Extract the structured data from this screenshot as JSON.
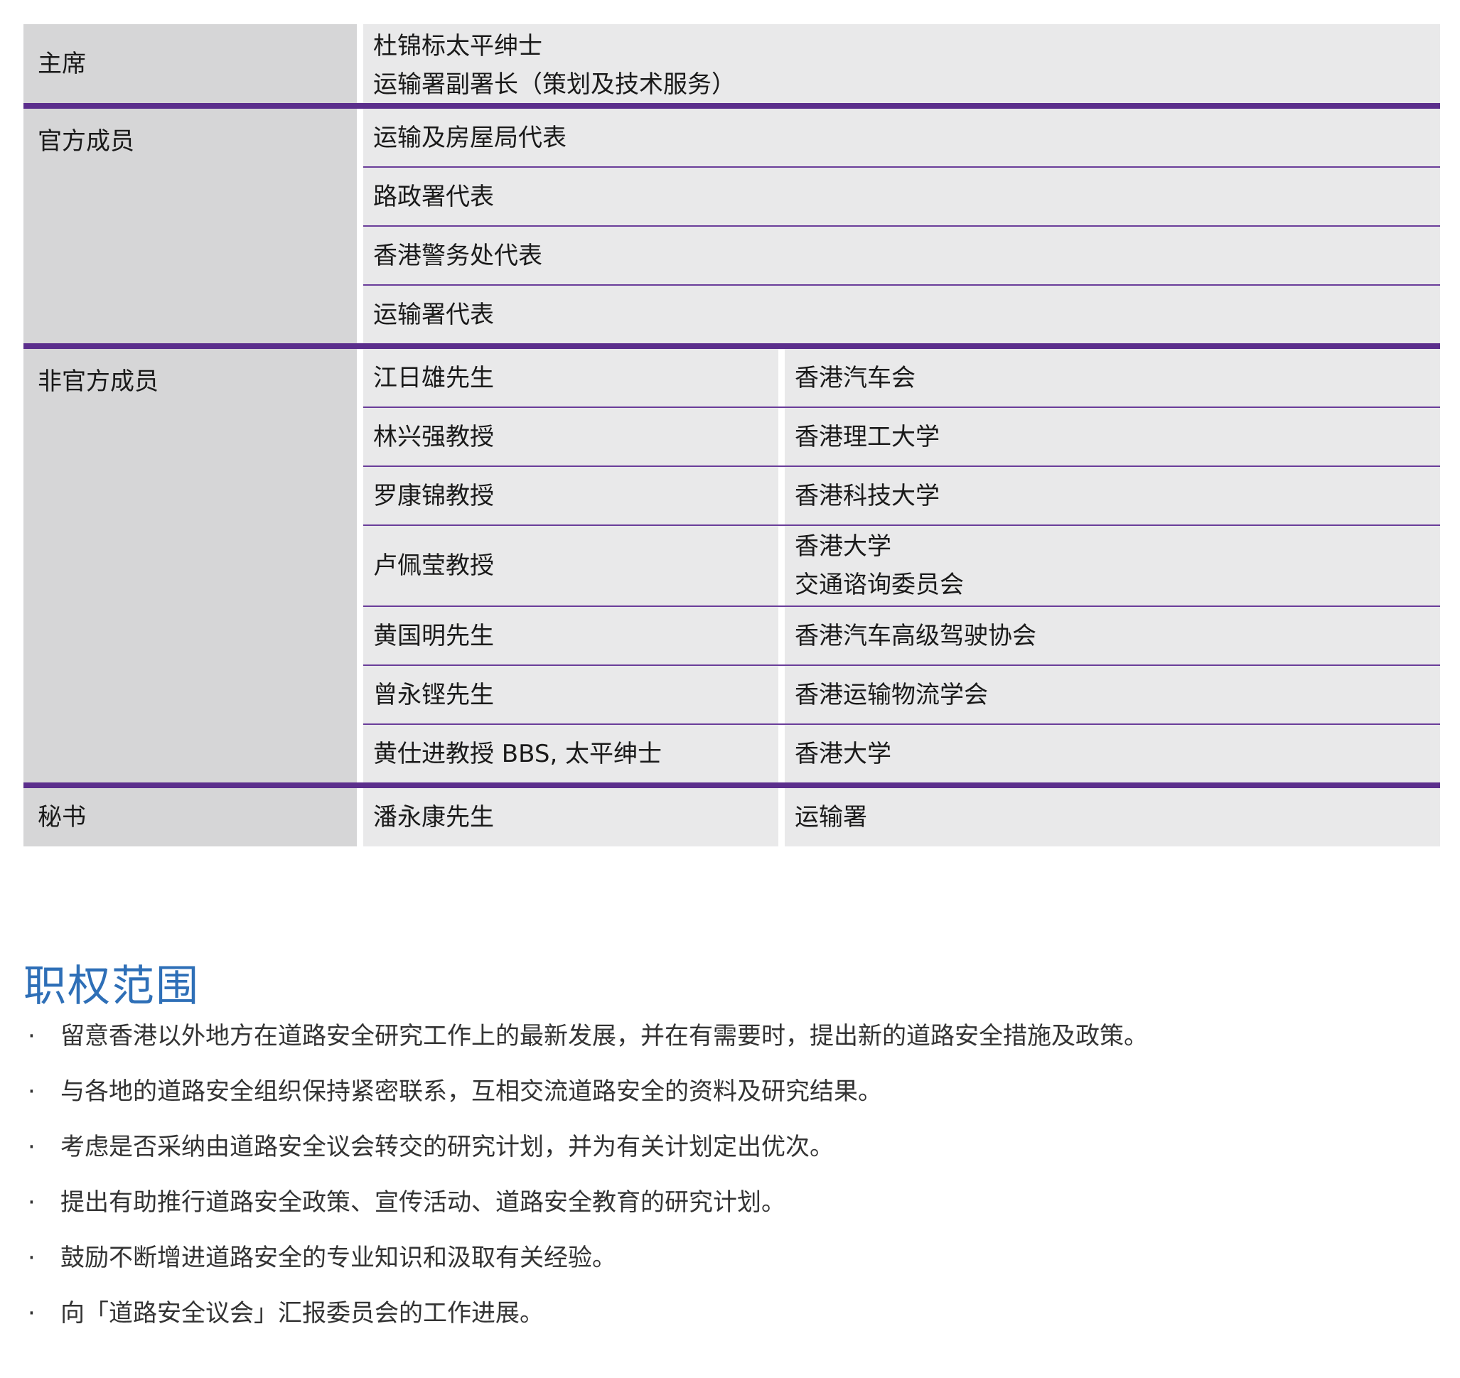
{
  "members": {
    "chair": {
      "label": "主席",
      "line1": "杜锦标太平绅士",
      "line2": "运输署副署长（策划及技术服务）"
    },
    "official": {
      "label": "官方成员",
      "rows": [
        "运输及房屋局代表",
        "路政署代表",
        "香港警务处代表",
        "运输署代表"
      ]
    },
    "unofficial": {
      "label": "非官方成员",
      "rows": [
        {
          "name": "江日雄先生",
          "org1": "香港汽车会",
          "org2": ""
        },
        {
          "name": "林兴强教授",
          "org1": "香港理工大学",
          "org2": ""
        },
        {
          "name": "罗康锦教授",
          "org1": "香港科技大学",
          "org2": ""
        },
        {
          "name": "卢佩莹教授",
          "org1": "香港大学",
          "org2": "交通谘询委员会"
        },
        {
          "name": "黄国明先生",
          "org1": "香港汽车高级驾驶协会",
          "org2": ""
        },
        {
          "name": "曾永铿先生",
          "org1": "香港运输物流学会",
          "org2": ""
        },
        {
          "name": "黄仕进教授 BBS, 太平绅士",
          "org1": "香港大学",
          "org2": ""
        }
      ]
    },
    "secretary": {
      "label": "秘书",
      "name": "潘永康先生",
      "org": "运输署"
    }
  },
  "terms": {
    "title": "职权范围",
    "bullet": "·",
    "items": [
      "留意香港以外地方在道路安全研究工作上的最新发展，并在有需要时，提出新的道路安全措施及政策。",
      "与各地的道路安全组织保持紧密联系，互相交流道路安全的资料及研究结果。",
      "考虑是否采纳由道路安全议会转交的研究计划，并为有关计划定出优次。",
      "提出有助推行道路安全政策、宣传活动、道路安全教育的研究计划。",
      "鼓励不断增进道路安全的专业知识和汲取有关经验。",
      "向「道路安全议会」汇报委员会的工作进展。"
    ]
  },
  "colors": {
    "divider": "#5b2e8c",
    "title": "#2e6fb7",
    "label_bg": "#d6d6d7",
    "cell_bg": "#e9e9ea"
  }
}
